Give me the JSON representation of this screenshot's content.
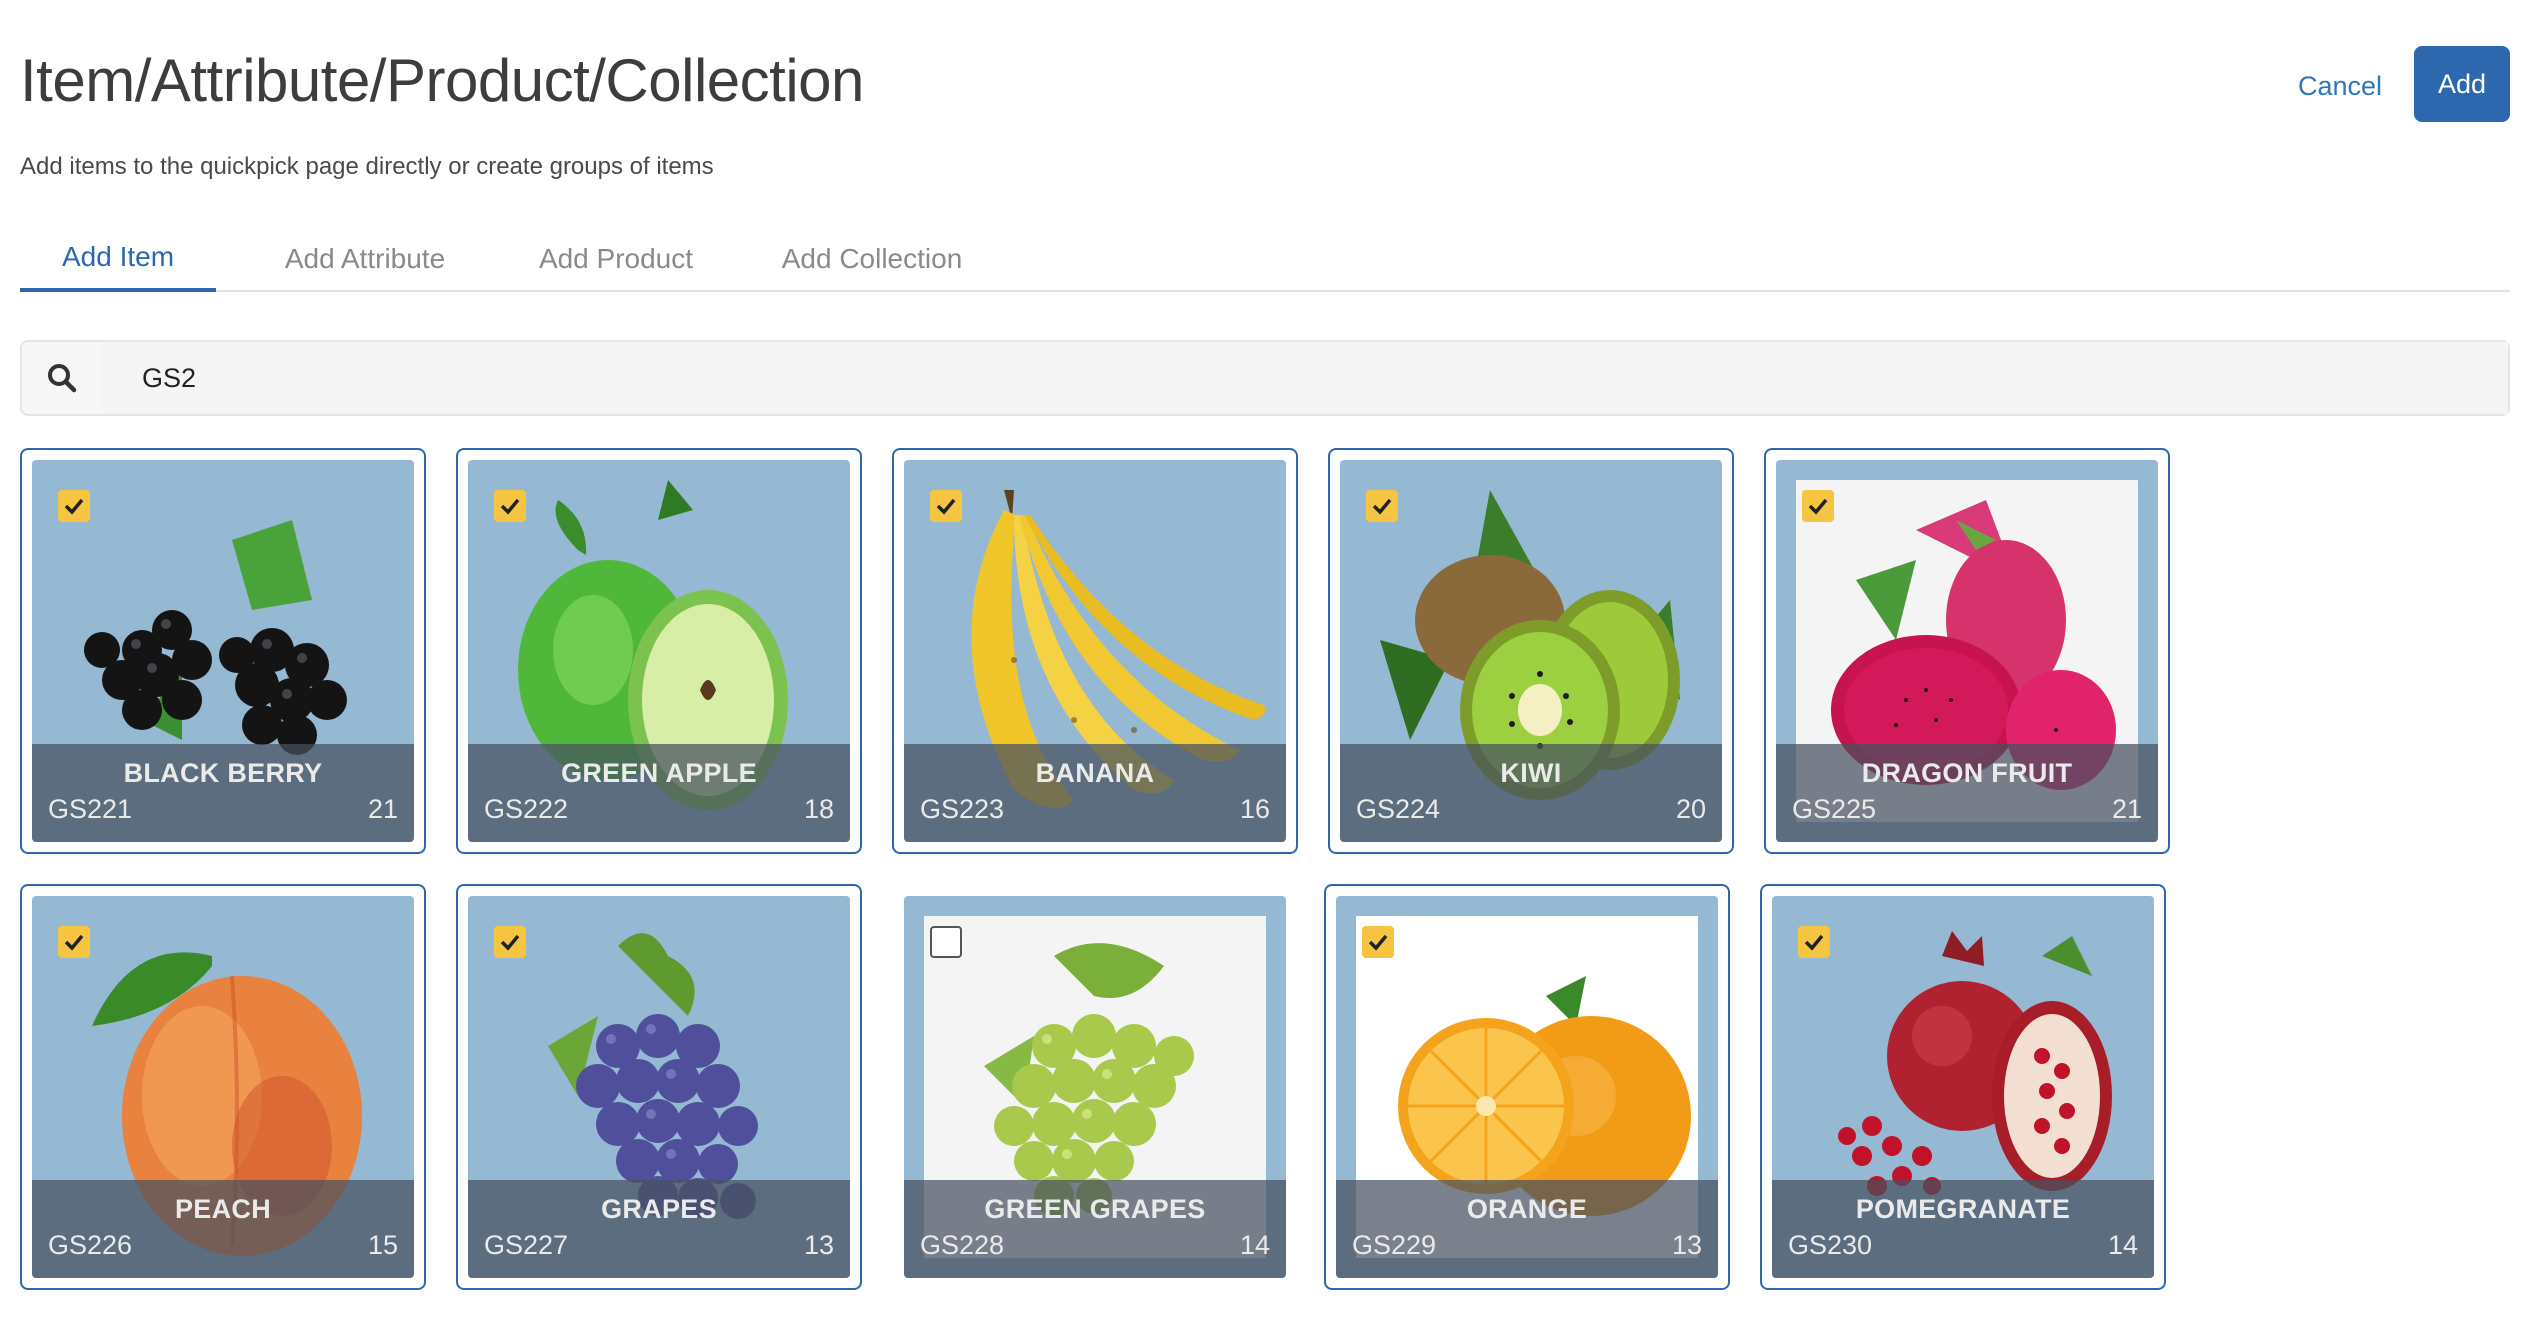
{
  "header": {
    "title": "Item/Attribute/Product/Collection",
    "subtitle": "Add items to the quickpick page directly or create groups of items",
    "cancel_label": "Cancel",
    "add_label": "Add"
  },
  "tabs": [
    {
      "label": "Add Item",
      "active": true
    },
    {
      "label": "Add Attribute",
      "active": false
    },
    {
      "label": "Add Product",
      "active": false
    },
    {
      "label": "Add Collection",
      "active": false
    }
  ],
  "search": {
    "value": "GS2",
    "icon": "search-icon"
  },
  "items": [
    {
      "name": "BLACK BERRY",
      "code": "GS221",
      "count": "21",
      "checked": true
    },
    {
      "name": "GREEN APPLE",
      "code": "GS222",
      "count": "18",
      "checked": true
    },
    {
      "name": "BANANA",
      "code": "GS223",
      "count": "16",
      "checked": true
    },
    {
      "name": "KIWI",
      "code": "GS224",
      "count": "20",
      "checked": true
    },
    {
      "name": "DRAGON FRUIT",
      "code": "GS225",
      "count": "21",
      "checked": true
    },
    {
      "name": "PEACH",
      "code": "GS226",
      "count": "15",
      "checked": true
    },
    {
      "name": "GRAPES",
      "code": "GS227",
      "count": "13",
      "checked": true
    },
    {
      "name": "GREEN GRAPES",
      "code": "GS228",
      "count": "14",
      "checked": false
    },
    {
      "name": "ORANGE",
      "code": "GS229",
      "count": "13",
      "checked": true
    },
    {
      "name": "POMEGRANATE",
      "code": "GS230",
      "count": "14",
      "checked": true
    }
  ],
  "colors": {
    "accent": "#2d68ae",
    "check": "#f5c542",
    "tile_bg": "#95b8d3"
  }
}
